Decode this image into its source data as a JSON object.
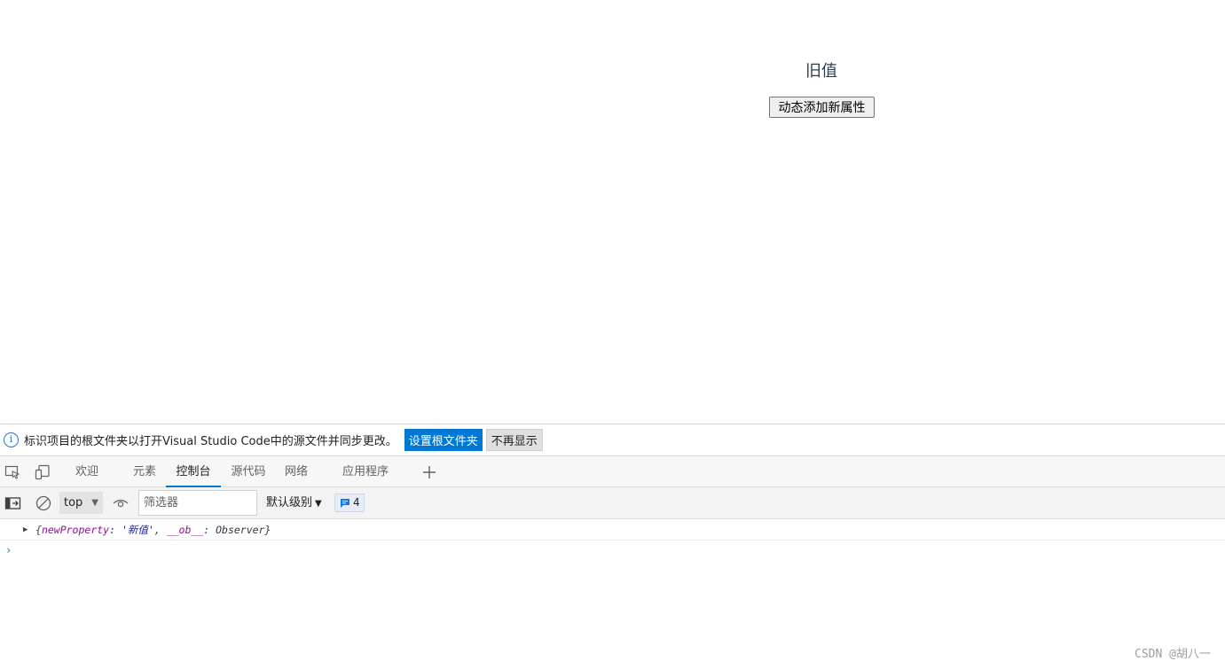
{
  "page": {
    "message": "旧值",
    "button_label": "动态添加新属性"
  },
  "infobar": {
    "icon": "info-icon",
    "text": "标识项目的根文件夹以打开Visual Studio Code中的源文件并同步更改。",
    "primary_label": "设置根文件夹",
    "secondary_label": "不再显示"
  },
  "devtools_tabs": {
    "icons": [
      "inspect-element-icon",
      "device-emulation-icon"
    ],
    "items": [
      {
        "label": "欢迎",
        "active": false
      },
      {
        "label": "元素",
        "active": false
      },
      {
        "label": "控制台",
        "active": true
      },
      {
        "label": "源代码",
        "active": false
      },
      {
        "label": "网络",
        "active": false
      },
      {
        "label": "应用程序",
        "active": false
      }
    ],
    "add_icon": "plus-icon"
  },
  "console_toolbar": {
    "icons": [
      "sidebar-toggle-icon",
      "clear-console-icon",
      "live-expression-eye-icon"
    ],
    "context": "top",
    "filter_placeholder": "筛选器",
    "level": "默认级别",
    "message_count": "4"
  },
  "console_output": {
    "log_open": "{",
    "prop_name": "newProperty",
    "colon1": ": ",
    "prop_value": "'新值'",
    "sep": ", ",
    "ob_name": "__ob__",
    "colon2": ": ",
    "ob_value": "Observer",
    "log_close": "}",
    "prompt": "›"
  },
  "watermark": "CSDN @胡八一",
  "colors": {
    "accent": "#0078d4",
    "link_blue": "#1a73e8",
    "property": "#881391",
    "string": "#1a1aa6"
  }
}
